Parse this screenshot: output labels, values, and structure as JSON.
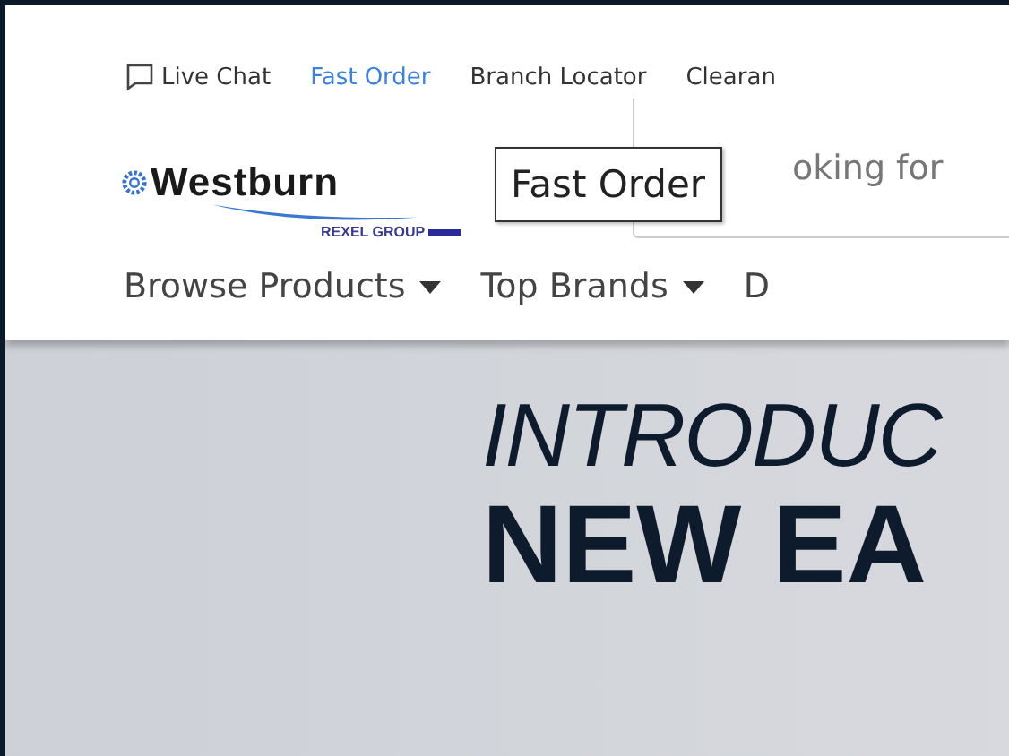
{
  "top_links": [
    {
      "label": "Live Chat",
      "kind": "chat",
      "selected": false
    },
    {
      "label": "Fast Order",
      "kind": "plain",
      "selected": true
    },
    {
      "label": "Branch Locator",
      "kind": "plain",
      "selected": false
    },
    {
      "label": "Clearan",
      "kind": "plain",
      "selected": false
    }
  ],
  "logo": {
    "name": "Westburn",
    "group": "REXEL GROUP"
  },
  "search": {
    "placeholder": "oking for"
  },
  "tooltip": "Fast Order",
  "nav": [
    {
      "label": "Browse Products",
      "dropdown": true
    },
    {
      "label": "Top Brands",
      "dropdown": true
    },
    {
      "label": "D",
      "dropdown": false
    }
  ],
  "hero": {
    "line_1": "INTRODUC",
    "line_2": "NEW EA"
  }
}
